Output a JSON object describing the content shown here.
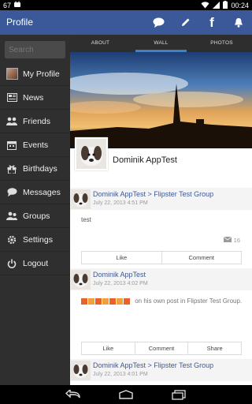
{
  "status_bar": {
    "left_text": "67",
    "time": "00:24"
  },
  "app_bar": {
    "title": "Profile",
    "actions": [
      "chat-icon",
      "pencil-icon",
      "facebook-icon",
      "bell-icon"
    ]
  },
  "sidebar": {
    "search_placeholder": "Search",
    "items": [
      {
        "label": "My Profile",
        "icon": "avatar"
      },
      {
        "label": "News",
        "icon": "news-icon"
      },
      {
        "label": "Friends",
        "icon": "friends-icon"
      },
      {
        "label": "Events",
        "icon": "calendar-icon"
      },
      {
        "label": "Birthdays",
        "icon": "gift-icon"
      },
      {
        "label": "Messages",
        "icon": "chat-icon"
      },
      {
        "label": "Groups",
        "icon": "groups-icon"
      },
      {
        "label": "Settings",
        "icon": "gear-icon"
      },
      {
        "label": "Logout",
        "icon": "power-icon"
      }
    ]
  },
  "tabs": [
    "ABOUT",
    "WALL",
    "PHOTOS"
  ],
  "profile": {
    "name": "Dominik AppTest"
  },
  "posts": [
    {
      "author": "Dominik AppTest  >  Flipster Test Group",
      "date": "July 22, 2013 4:51 PM",
      "body": "test",
      "comment_count": "16",
      "buttons": [
        "Like",
        "Comment"
      ]
    },
    {
      "author": "Dominik AppTest",
      "date": "July 22, 2013 4:02 PM",
      "body": "on his own post in Flipster Test Group.",
      "buttons": [
        "Like",
        "Comment",
        "Share"
      ]
    },
    {
      "author": "Dominik AppTest  >  Flipster Test Group",
      "date": "July 22, 2013 4:01 PM"
    }
  ],
  "colors": {
    "brand": "#3b5998",
    "sidebar": "#2f2f2f",
    "tab_indicator": "#3b83c4"
  }
}
